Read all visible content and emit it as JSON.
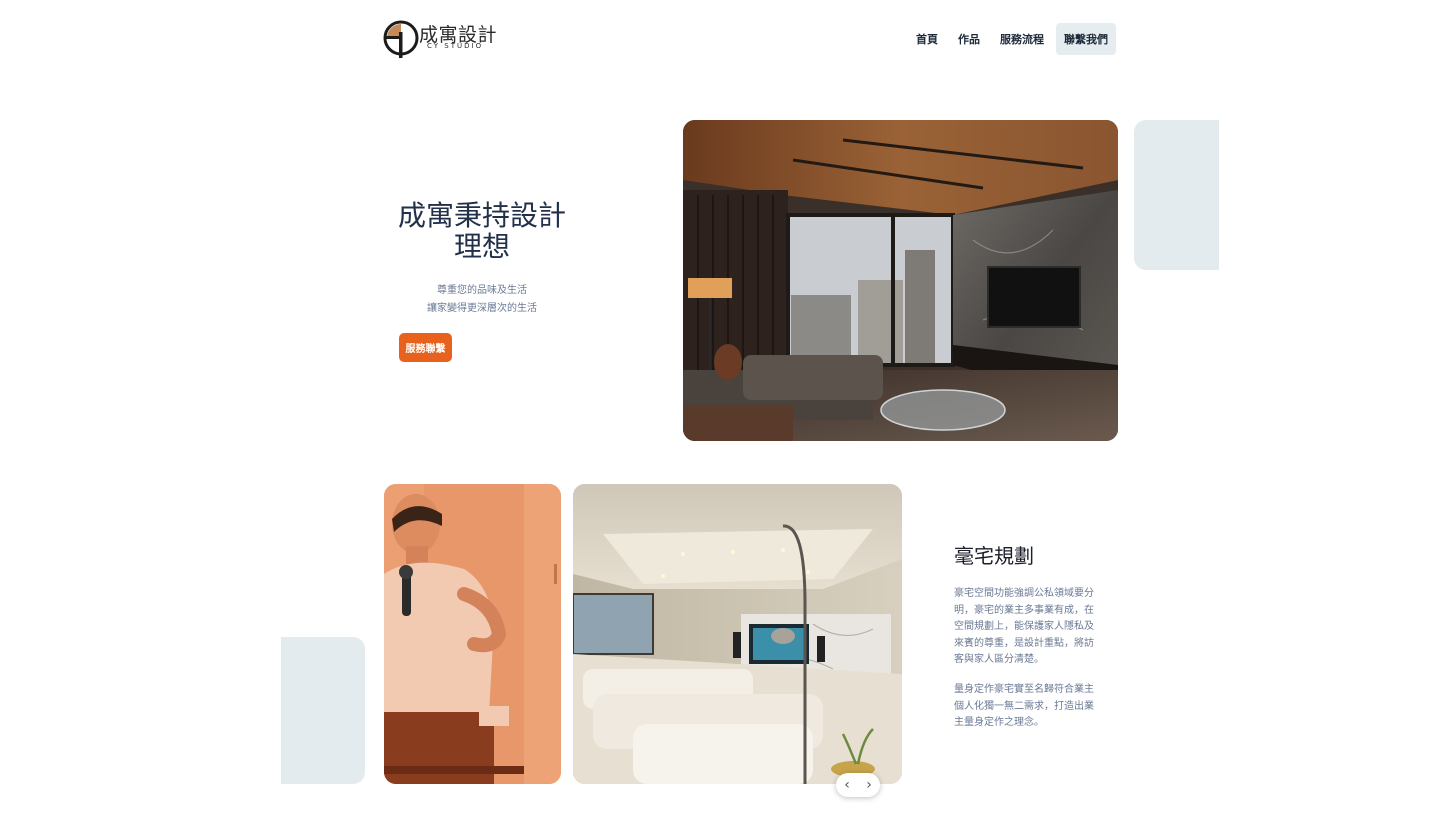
{
  "brand": {
    "name": "成寓設計",
    "sub": "CY STUDIO"
  },
  "nav": {
    "items": [
      "首頁",
      "作品",
      "服務流程",
      "聯繫我們"
    ]
  },
  "hero": {
    "title": "成寓秉持設計理想",
    "line1": "尊重您的品味及生活",
    "line2": "讓家變得更深層次的生活",
    "cta": "服務聯繫"
  },
  "section": {
    "title": "毫宅規劃",
    "p1": "豪宅空間功能強調公私領域要分明，豪宅的業主多事業有成，在空間規劃上，能保護家人隱私及來賓的尊重，是設計重點，將訪客與家人區分清楚。",
    "p2": "量身定作豪宅實至名歸符合業主個人化獨一無二需求，打造出業主量身定作之理念。"
  },
  "slider": {
    "prev": "‹",
    "next": "›"
  },
  "colors": {
    "accent": "#e8621d",
    "navy": "#22304a",
    "muted": "#6b7a95",
    "panel": "#e4ebee"
  }
}
